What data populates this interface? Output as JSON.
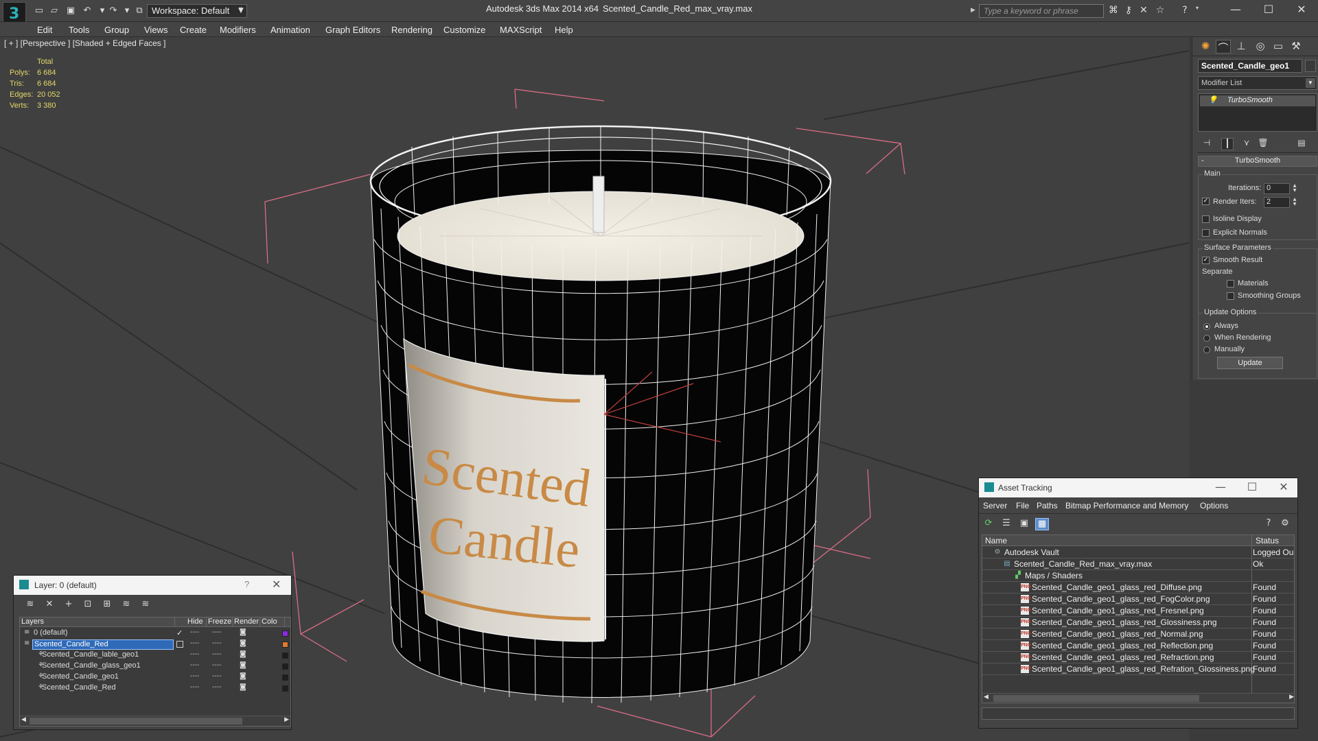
{
  "app": {
    "title": "Autodesk 3ds Max 2014 x64",
    "file": "Scented_Candle_Red_max_vray.max",
    "workspace": "Workspace: Default",
    "search_placeholder": "Type a keyword or phrase",
    "accent": "#2bb3b8"
  },
  "menu": [
    "Edit",
    "Tools",
    "Group",
    "Views",
    "Create",
    "Modifiers",
    "Animation",
    "Graph Editors",
    "Rendering",
    "Customize",
    "MAXScript",
    "Help"
  ],
  "viewport": {
    "label": "[ + ] [Perspective ] [Shaded + Edged Faces ]",
    "stats": {
      "header": "Total",
      "rows": [
        {
          "k": "Polys:",
          "v": "6 684"
        },
        {
          "k": "Tris:",
          "v": "6 684"
        },
        {
          "k": "Edges:",
          "v": "20 052"
        },
        {
          "k": "Verts:",
          "v": "3 380"
        }
      ]
    },
    "label_text_line1": "Scented",
    "label_text_line2": "Candle"
  },
  "command_panel": {
    "object_name": "Scented_Candle_geo1",
    "modifier_list": "Modifier List",
    "stack_item": "TurboSmooth",
    "rollout_title": "TurboSmooth",
    "main_label": "Main",
    "iterations_label": "Iterations:",
    "iterations_value": "0",
    "render_iters_label": "Render Iters:",
    "render_iters_value": "2",
    "isoline_label": "Isoline Display",
    "explicit_normals_label": "Explicit Normals",
    "surface_params_label": "Surface Parameters",
    "smooth_result_label": "Smooth Result",
    "separate_label": "Separate",
    "materials_label": "Materials",
    "smoothing_groups_label": "Smoothing Groups",
    "update_options_label": "Update Options",
    "always_label": "Always",
    "when_rendering_label": "When Rendering",
    "manually_label": "Manually",
    "update_button": "Update"
  },
  "layer_window": {
    "title": "Layer: 0 (default)",
    "help": "?",
    "columns": [
      "Layers",
      "Hide",
      "Freeze",
      "Render",
      "Colo"
    ],
    "rows": [
      {
        "name": "0 (default)",
        "indent": 1,
        "checked": true,
        "color": "#8a2be2",
        "selected": false
      },
      {
        "name": "Scented_Candle_Red",
        "indent": 1,
        "checked": false,
        "color": "#e07a2e",
        "selected": true
      },
      {
        "name": "Scented_Candle_lable_geo1",
        "indent": 2,
        "checked": false,
        "color": "#1e1e1e",
        "selected": false
      },
      {
        "name": "Scented_Candle_glass_geo1",
        "indent": 2,
        "checked": false,
        "color": "#1e1e1e",
        "selected": false
      },
      {
        "name": "Scented_Candle_geo1",
        "indent": 2,
        "checked": false,
        "color": "#1e1e1e",
        "selected": false
      },
      {
        "name": "Scented_Candle_Red",
        "indent": 2,
        "checked": false,
        "color": "#1e1e1e",
        "selected": false
      }
    ],
    "dash": "----"
  },
  "asset_tracking": {
    "title": "Asset Tracking",
    "menu": [
      "Server",
      "File",
      "Paths",
      "Bitmap Performance and Memory",
      "Options"
    ],
    "columns": [
      "Name",
      "Status"
    ],
    "rows": [
      {
        "name": "Autodesk Vault",
        "status": "Logged Ou",
        "indent": 0,
        "icon": "vault"
      },
      {
        "name": "Scented_Candle_Red_max_vray.max",
        "status": "Ok",
        "indent": 1,
        "icon": "max"
      },
      {
        "name": "Maps / Shaders",
        "status": "",
        "indent": 2,
        "icon": "maps"
      },
      {
        "name": "Scented_Candle_geo1_glass_red_Diffuse.png",
        "status": "Found",
        "indent": 3,
        "icon": "png"
      },
      {
        "name": "Scented_Candle_geo1_glass_red_FogColor.png",
        "status": "Found",
        "indent": 3,
        "icon": "png"
      },
      {
        "name": "Scented_Candle_geo1_glass_red_Fresnel.png",
        "status": "Found",
        "indent": 3,
        "icon": "png"
      },
      {
        "name": "Scented_Candle_geo1_glass_red_Glossiness.png",
        "status": "Found",
        "indent": 3,
        "icon": "png"
      },
      {
        "name": "Scented_Candle_geo1_glass_red_Normal.png",
        "status": "Found",
        "indent": 3,
        "icon": "png"
      },
      {
        "name": "Scented_Candle_geo1_glass_red_Reflection.png",
        "status": "Found",
        "indent": 3,
        "icon": "png"
      },
      {
        "name": "Scented_Candle_geo1_glass_red_Refraction.png",
        "status": "Found",
        "indent": 3,
        "icon": "png"
      },
      {
        "name": "Scented_Candle_geo1_glass_red_Refration_Glossiness.png",
        "status": "Found",
        "indent": 3,
        "icon": "png"
      }
    ],
    "png_badge": "PNG"
  }
}
